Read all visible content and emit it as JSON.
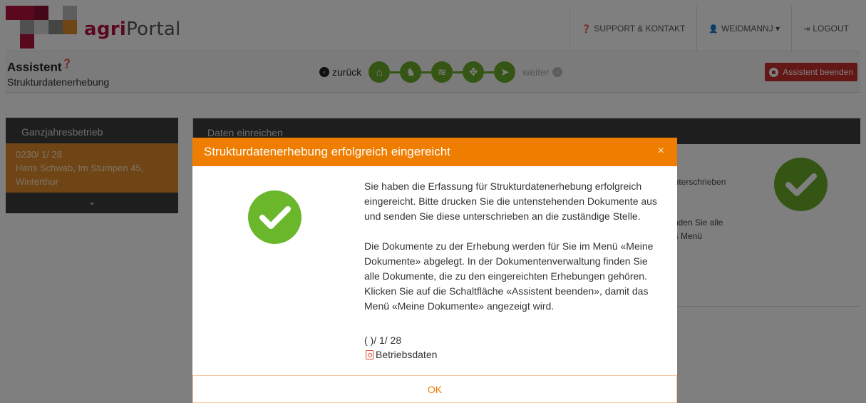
{
  "app": {
    "brand_agri": "agri",
    "brand_portal": "Portal",
    "brand_colors": [
      "#b3113a",
      "#d4d4d4",
      "#e08a2a",
      "#8a8a8a"
    ]
  },
  "topnav": {
    "support": {
      "icon": "question-circle-icon",
      "label": "SUPPORT & KONTAKT"
    },
    "user": {
      "icon": "user-icon",
      "label": "WEIDMANNJ",
      "caret": "▾"
    },
    "logout": {
      "icon": "sign-out-icon",
      "label": "LOGOUT"
    }
  },
  "wizard": {
    "title": "Assistent",
    "subtitle": "Strukturdatenerhebung",
    "back_label": "zurück",
    "next_label": "weiter",
    "end_label": "Assistent beenden",
    "steps": [
      {
        "icon": "home-icon",
        "glyph": "⌂"
      },
      {
        "icon": "cow-icon",
        "glyph": "♞"
      },
      {
        "icon": "layers-icon",
        "glyph": "≋"
      },
      {
        "icon": "crosshair-icon",
        "glyph": "✥"
      },
      {
        "icon": "send-icon",
        "glyph": "➤"
      }
    ]
  },
  "sidebar": {
    "header": "Ganzjahresbetrieb",
    "farm_id": "0230/ 1/ 28",
    "farm_address": "Hans Schwab, Im Stumpen 45, Winterthur",
    "toggle": "⌄"
  },
  "main": {
    "header": "Daten einreichen",
    "bg_line1": "unterschrieben",
    "bg_line2": "finden Sie alle",
    "bg_line3": "as Menü"
  },
  "modal": {
    "title": "Strukturdatenerhebung erfolgreich eingereicht",
    "close": "×",
    "paragraph1": "Sie haben die Erfassung für Strukturdatenerhebung erfolgreich eingereicht. Bitte drucken Sie die untenstehenden Dokumente aus und senden Sie diese unterschrieben an die zuständige Stelle.",
    "paragraph2": "Die Dokumente zu der Erhebung werden für Sie im Menü «Meine Dokumente» abgelegt. In der Dokumentenverwaltung finden Sie alle Dokumente, die zu den eingereichten Erhebungen gehören. Klicken Sie auf die Schaltfläche «Assistent beenden», damit das Menü «Meine Dokumente» angezeigt wird.",
    "doc_id": "(   )/ 1/ 28",
    "doc_link": "Betriebsdaten",
    "ok_label": "OK",
    "accent_color": "#ef7d00"
  }
}
